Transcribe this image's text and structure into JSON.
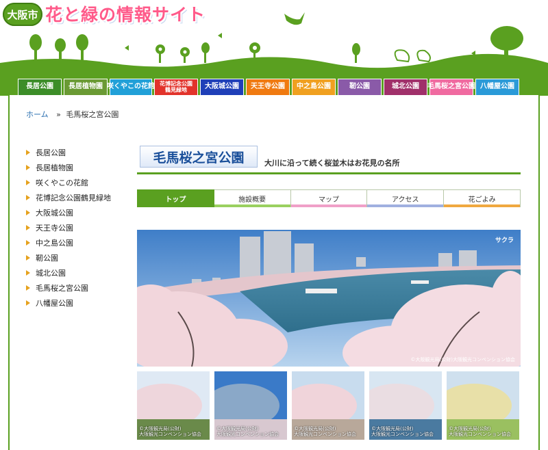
{
  "header": {
    "city_label": "大阪市",
    "site_title": "花と緑の情報サイト"
  },
  "park_tabs": [
    {
      "label": "長居公園",
      "color": "#3c8d28"
    },
    {
      "label": "長居植物園",
      "color": "#6a9a34"
    },
    {
      "label": "咲くやこの花館",
      "color": "#21a0d8"
    },
    {
      "label": "花博記念公園\n鶴見緑地",
      "color": "#e2332b"
    },
    {
      "label": "大阪城公園",
      "color": "#1f3fb8"
    },
    {
      "label": "天王寺公園",
      "color": "#f07a10"
    },
    {
      "label": "中之島公園",
      "color": "#f0a020"
    },
    {
      "label": "靭公園",
      "color": "#8a5aa8"
    },
    {
      "label": "城北公園",
      "color": "#a0306a"
    },
    {
      "label": "毛馬桜之宮公園",
      "color": "#f06aa0"
    },
    {
      "label": "八幡屋公園",
      "color": "#2a9ad8"
    }
  ],
  "breadcrumb": {
    "home": "ホーム",
    "separator": "»",
    "current": "毛馬桜之宮公園"
  },
  "sidebar": {
    "items": [
      "長居公園",
      "長居植物園",
      "咲くやこの花館",
      "花博記念公園鶴見緑地",
      "大阪城公園",
      "天王寺公園",
      "中之島公園",
      "靭公園",
      "城北公園",
      "毛馬桜之宮公園",
      "八幡屋公園"
    ]
  },
  "page": {
    "title": "毛馬桜之宮公園",
    "subtitle": "大川に沿って続く桜並木はお花見の名所"
  },
  "sub_tabs": [
    {
      "label": "トップ",
      "accent": "#5aa020"
    },
    {
      "label": "施設概要",
      "accent": "#9ad060"
    },
    {
      "label": "マップ",
      "accent": "#f0a0c8"
    },
    {
      "label": "アクセス",
      "accent": "#a0b0e0"
    },
    {
      "label": "花ごよみ",
      "accent": "#f0a840"
    }
  ],
  "main_photo": {
    "label": "サクラ",
    "credit": "©大阪観光局(公財)大阪観光コンベンション協会"
  },
  "thumbnails": [
    {
      "credit_line1": "©大阪観光局(公財)",
      "credit_line2": "大阪観光コンベンション協会"
    },
    {
      "credit_line1": "©大阪観光局(公財)",
      "credit_line2": "大阪観光コンベンション協会"
    },
    {
      "credit_line1": "©大阪観光局(公財)",
      "credit_line2": "大阪観光コンベンション協会"
    },
    {
      "credit_line1": "©大阪観光局(公財)",
      "credit_line2": "大阪観光コンベンション協会"
    },
    {
      "credit_line1": "©大阪観光局(公財)",
      "credit_line2": "大阪観光コンベンション協会"
    }
  ]
}
